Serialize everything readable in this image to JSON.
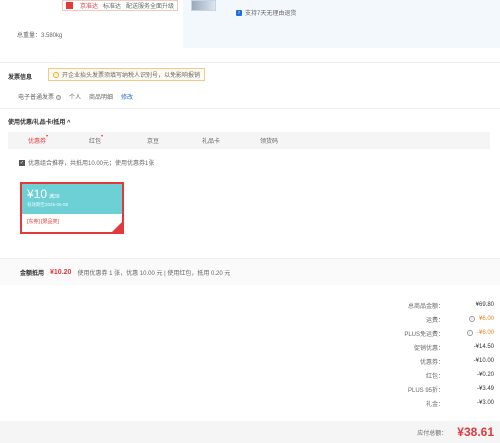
{
  "shipping": {
    "badges": [
      "京准达",
      "标准达",
      "配送服务全面升级"
    ],
    "weight": "总重量：3.580kg"
  },
  "product": {
    "return_policy": "支持7天无理由退货"
  },
  "invoice": {
    "title": "发票信息",
    "tip": "开企业抬头发票须填写纳税人识别号，以免影响报销",
    "type": "电子普通发票",
    "owner": "个人",
    "detail": "商品明细",
    "edit": "修改"
  },
  "coupons": {
    "title": "使用优惠/礼品卡/抵用 ^",
    "tabs": [
      {
        "label": "优惠券",
        "dot": true,
        "active": true
      },
      {
        "label": "红包",
        "dot": true,
        "active": false
      },
      {
        "label": "京豆",
        "dot": false,
        "active": false
      },
      {
        "label": "礼品卡",
        "dot": false,
        "active": false
      },
      {
        "label": "领货码",
        "dot": false,
        "active": false
      }
    ],
    "combo_text": "优惠组合推荐，共抵用10.00元；使用优惠券1张",
    "card": {
      "amount": "¥10",
      "threshold": "满39",
      "valid": "有效期至2025-05-08",
      "limit": "[东券] [限品类]"
    },
    "summary_label": "金额抵用",
    "summary_amount": "¥10.20",
    "summary_detail": "使用优惠券 1 张，优惠 10.00 元 | 使用红包，抵用 0.20 元"
  },
  "totals": [
    {
      "label": "总商品金额：",
      "value": "¥69.80",
      "info": false,
      "orange": false
    },
    {
      "label": "运费：",
      "value": "¥6.00",
      "info": true,
      "orange": true
    },
    {
      "label": "PLUS免运费：",
      "value": "-¥6.00",
      "info": true,
      "orange": true
    },
    {
      "label": "促销优惠：",
      "value": "-¥14.50",
      "info": false,
      "orange": false
    },
    {
      "label": "优惠券：",
      "value": "-¥10.00",
      "info": false,
      "orange": false
    },
    {
      "label": "红包：",
      "value": "-¥0.20",
      "info": false,
      "orange": false
    },
    {
      "label": "PLUS 95折：",
      "value": "-¥3.49",
      "info": false,
      "orange": false
    },
    {
      "label": "礼金：",
      "value": "-¥3.00",
      "info": false,
      "orange": false
    }
  ],
  "payable": {
    "label": "应付总额：",
    "total": "¥38.61"
  }
}
